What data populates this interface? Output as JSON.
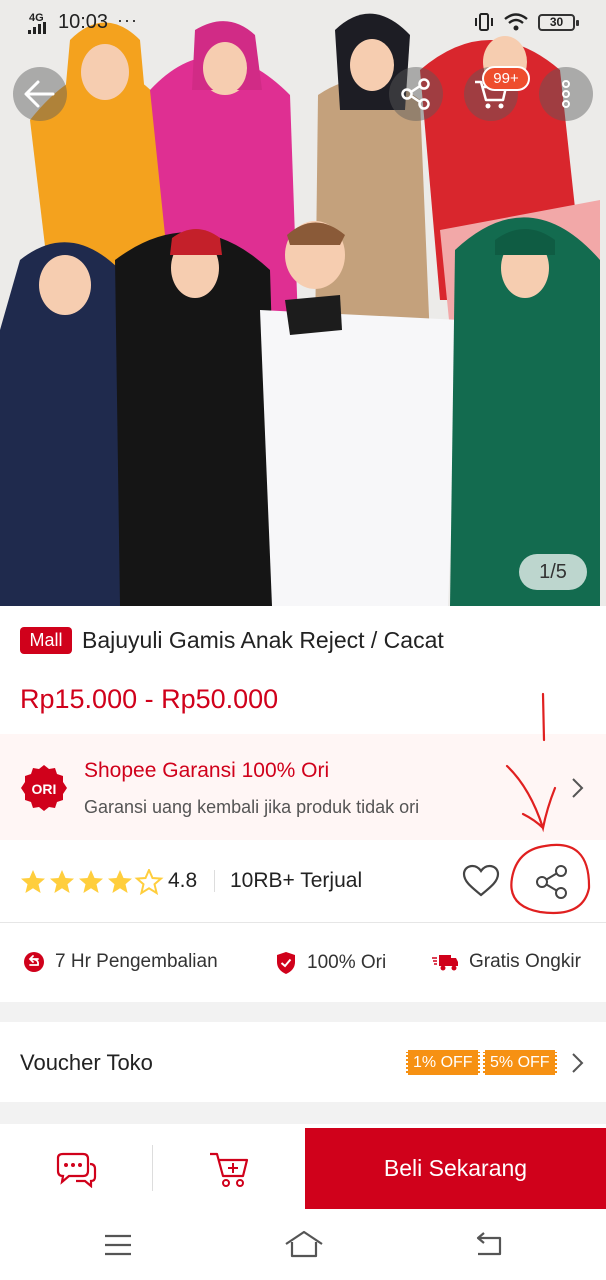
{
  "status_bar": {
    "network": "4G",
    "time": "10:03",
    "dots": "···",
    "battery": "30"
  },
  "header": {
    "cart_badge": "99+",
    "image_counter": "1/5"
  },
  "product": {
    "mall_badge": "Mall",
    "title": "Bajuyuli Gamis Anak Reject / Cacat",
    "price": "Rp15.000 - Rp50.000"
  },
  "guarantee": {
    "logo_text": "ORI",
    "title": "Shopee Garansi 100% Ori",
    "subtitle": "Garansi uang kembali jika produk tidak ori"
  },
  "rating": {
    "value": "4.8",
    "stars": 4.5,
    "sold": "10RB+ Terjual"
  },
  "features": [
    {
      "icon": "return-icon",
      "label": "7 Hr Pengembalian"
    },
    {
      "icon": "shield-check-icon",
      "label": "100% Ori"
    },
    {
      "icon": "truck-icon",
      "label": "Gratis Ongkir"
    }
  ],
  "voucher": {
    "label": "Voucher Toko",
    "tags": [
      "1% OFF",
      "5% OFF"
    ]
  },
  "bottom_bar": {
    "buy_label": "Beli Sekarang"
  },
  "colors": {
    "brand_red": "#d0011b",
    "shopee_orange": "#ee4d2d",
    "voucher_orange": "#f69113",
    "star": "#ffce3d"
  }
}
